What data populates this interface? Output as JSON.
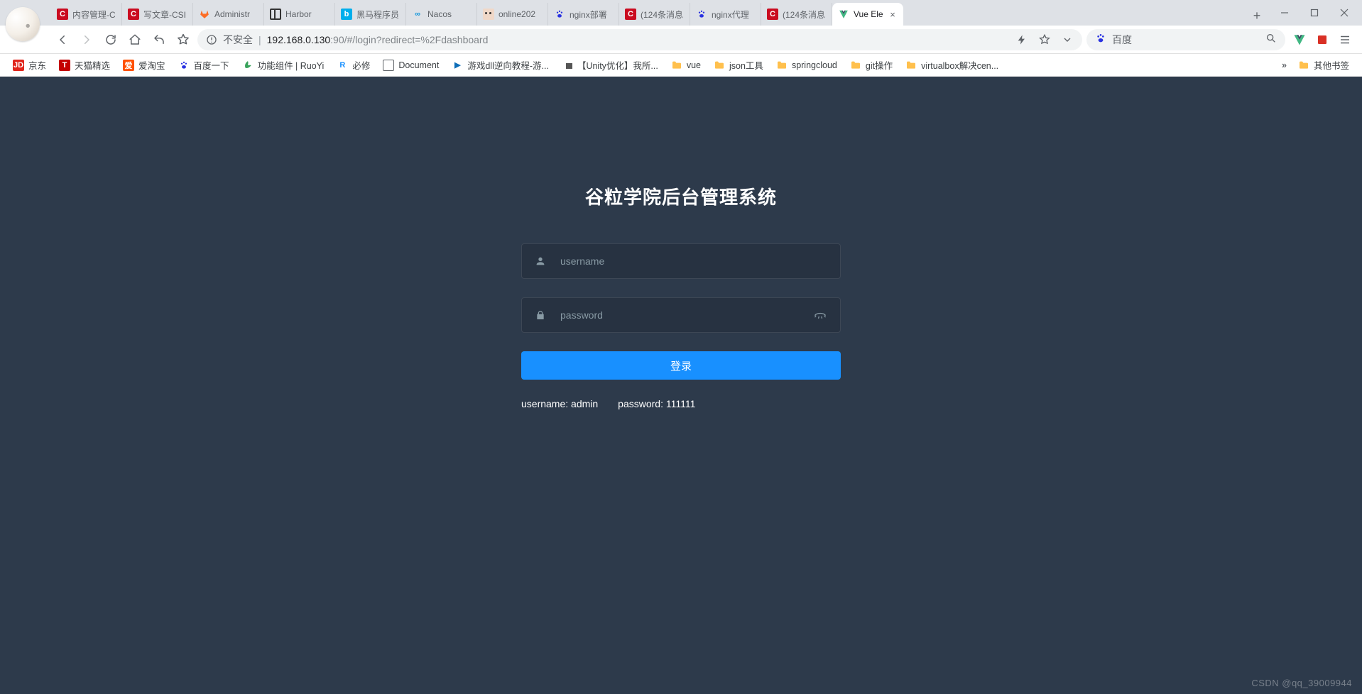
{
  "window": {
    "minimize_tooltip": "Minimize",
    "maximize_tooltip": "Maximize",
    "close_tooltip": "Close"
  },
  "tabs": [
    {
      "icon": "c",
      "icon_class": "fc-c",
      "label": "内容管理-C"
    },
    {
      "icon": "c",
      "icon_class": "fc-c",
      "label": "写文章-CSI"
    },
    {
      "icon": "gitlab",
      "icon_class": "fc-gitlab",
      "label": "Administr"
    },
    {
      "icon": "harbor",
      "icon_class": "fc-harbor",
      "label": "Harbor"
    },
    {
      "icon": "bili",
      "icon_class": "fc-bili",
      "label": "黑马程序员"
    },
    {
      "icon": "nacos",
      "icon_class": "fc-nacos",
      "label": "Nacos"
    },
    {
      "icon": "face",
      "icon_class": "fc-face",
      "label": "online202"
    },
    {
      "icon": "baidu",
      "icon_class": "fc-baidu",
      "label": "nginx部署"
    },
    {
      "icon": "c",
      "icon_class": "fc-c",
      "label": "(124条消息"
    },
    {
      "icon": "baidu",
      "icon_class": "fc-baidu",
      "label": "nginx代理"
    },
    {
      "icon": "c",
      "icon_class": "fc-c",
      "label": "(124条消息"
    },
    {
      "icon": "vue",
      "icon_class": "fc-vue",
      "label": "Vue Ele",
      "active": true
    }
  ],
  "newtab_label": "+",
  "toolbar": {
    "insecure_label": "不安全",
    "url_host": "192.168.0.130",
    "url_port_path": ":90/#/login?redirect=%2Fdashboard",
    "search_engine": "百度"
  },
  "bookmarks": [
    {
      "style": "b-jd",
      "icon": "JD",
      "label": "京东"
    },
    {
      "style": "b-tm",
      "icon": "T",
      "label": "天猫精选"
    },
    {
      "style": "b-atb",
      "icon": "爱",
      "label": "爱淘宝"
    },
    {
      "style": "b-baidu",
      "icon": "paw",
      "label": "百度一下"
    },
    {
      "style": "b-leaf",
      "icon": "leaf",
      "label": "功能组件 | RuoYi"
    },
    {
      "style": "b-ruoyi",
      "icon": "R",
      "label": "必修"
    },
    {
      "style": "b-doc",
      "icon": "",
      "label": "Document"
    },
    {
      "style": "b-game",
      "icon": "▶",
      "label": "游戏dll逆向教程-游..."
    },
    {
      "style": "",
      "icon": "flag",
      "label": "【Unity优化】我所..."
    },
    {
      "style": "b-folder",
      "icon": "folder",
      "label": "vue"
    },
    {
      "style": "b-folder",
      "icon": "folder",
      "label": "json工具"
    },
    {
      "style": "b-folder",
      "icon": "folder",
      "label": "springcloud"
    },
    {
      "style": "b-folder",
      "icon": "folder",
      "label": "git操作"
    },
    {
      "style": "b-folder",
      "icon": "folder",
      "label": "virtualbox解决cen..."
    }
  ],
  "bookmarks_overflow": "»",
  "bookmarks_other": "其他书签",
  "login": {
    "title": "谷粒学院后台管理系统",
    "username_placeholder": "username",
    "password_placeholder": "password",
    "button": "登录",
    "tip_user": "username: admin",
    "tip_pass": "password: 111111"
  },
  "watermark": "CSDN @qq_39009944"
}
